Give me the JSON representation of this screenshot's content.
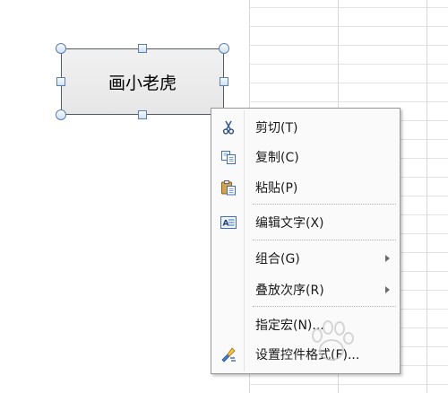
{
  "shape": {
    "text": "画小老虎"
  },
  "context_menu": {
    "items": [
      {
        "label": "剪切(T)",
        "icon": "scissors-icon"
      },
      {
        "label": "复制(C)",
        "icon": "copy-icon"
      },
      {
        "label": "粘贴(P)",
        "icon": "paste-icon"
      },
      {
        "label": "编辑文字(X)",
        "icon": "edit-text-icon"
      },
      {
        "label": "组合(G)",
        "submenu": true
      },
      {
        "label": "叠放次序(R)",
        "submenu": true
      },
      {
        "label": "指定宏(N)..."
      },
      {
        "label": "设置控件格式(F)...",
        "icon": "format-control-icon"
      }
    ]
  },
  "colors": {
    "menu_background": "#fafafa",
    "menu_border": "#979797",
    "shape_border": "#555a62",
    "handle_border": "#5d7fa8"
  }
}
